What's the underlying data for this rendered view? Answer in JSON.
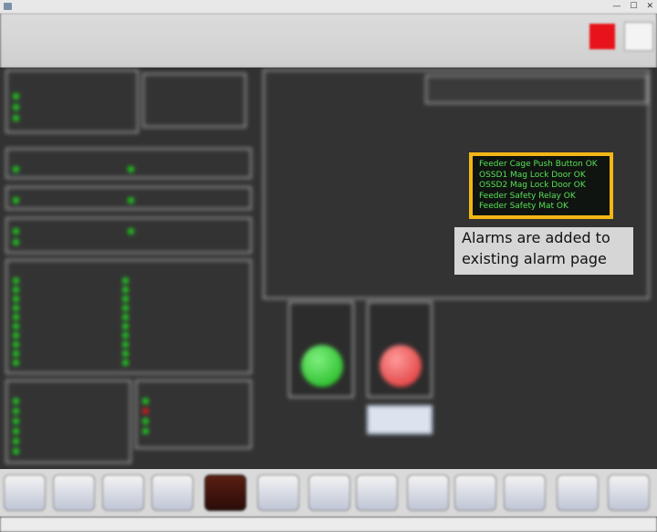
{
  "window": {
    "title": "",
    "controls": [
      "—",
      "☐",
      "✕"
    ]
  },
  "status_bar": {
    "groups": [
      {
        "rows": [
          [
            "",
            ""
          ],
          [
            "",
            ""
          ],
          [
            "",
            ""
          ],
          [
            "",
            ""
          ]
        ]
      },
      {
        "rows": [
          [
            "",
            ""
          ],
          [
            "",
            ""
          ],
          [
            "",
            ""
          ],
          [
            "",
            ""
          ]
        ]
      },
      {
        "rows": [
          [
            "",
            ""
          ],
          [
            "",
            ""
          ],
          [
            "",
            ""
          ],
          [
            "",
            ""
          ]
        ]
      },
      {
        "rows": [
          [
            "",
            ""
          ],
          [
            "",
            ""
          ],
          [
            "",
            ""
          ],
          [
            "",
            ""
          ]
        ]
      },
      {
        "rows": [
          [
            "",
            ""
          ],
          [
            "",
            ""
          ],
          [
            "",
            ""
          ],
          [
            "",
            ""
          ]
        ]
      }
    ],
    "alarm_color": "#e8131a"
  },
  "panels": {
    "hpu_status": {
      "title": "",
      "items": [
        "",
        "",
        ""
      ]
    },
    "alarms": {
      "title": ""
    },
    "planer_interlocks": {
      "title": ""
    },
    "top_right_note": {
      "text": ""
    },
    "group_a": {
      "title": "",
      "subtitle": "",
      "items": [
        "",
        ""
      ]
    },
    "group_b": {
      "title": "",
      "items": [
        "",
        ""
      ]
    },
    "group_c": {
      "title": "",
      "items": [
        "",
        "",
        ""
      ]
    },
    "servo_valve": {
      "title": "",
      "left": [
        "",
        "",
        "",
        "",
        "",
        "",
        "",
        "",
        "",
        ""
      ],
      "right": [
        "",
        "",
        "",
        "",
        "",
        "",
        "",
        "",
        "",
        ""
      ]
    },
    "dts_status": {
      "title": "",
      "items": [
        "",
        "",
        "",
        "",
        "",
        ""
      ]
    },
    "lineshear_status": {
      "title": "",
      "items": [
        "",
        "",
        "",
        ""
      ]
    },
    "interlock_list": [
      "",
      "",
      "",
      "",
      "",
      "",
      "",
      "",
      "",
      "",
      "",
      "",
      "",
      "",
      "",
      "",
      "",
      "",
      "",
      "",
      ""
    ],
    "interlock_list_right": [
      "",
      "",
      "",
      "",
      ""
    ]
  },
  "indicators": {
    "left": {
      "label": "",
      "color": "#1fc21f"
    },
    "right": {
      "label": "",
      "color": "#e23a3a"
    },
    "button_label": ""
  },
  "highlight": {
    "items": [
      "Feeder Cage Push Button OK",
      "OSSD1 Mag Lock Door OK",
      "OSSD2 Mag Lock Door OK",
      "Feeder Safety Relay OK",
      "Feeder Safety Mat OK"
    ],
    "border_color": "#f2b714"
  },
  "callout": {
    "lines": [
      "Alarms are added to",
      "existing alarm page"
    ]
  },
  "footer": {
    "buttons": [
      "",
      "",
      "",
      "",
      "",
      "",
      "",
      "",
      "",
      "",
      "",
      "",
      "",
      "",
      "",
      "",
      "",
      ""
    ]
  },
  "bottom_bar": {
    "segments": [
      "",
      "",
      "",
      "",
      "",
      "",
      "",
      ""
    ]
  }
}
